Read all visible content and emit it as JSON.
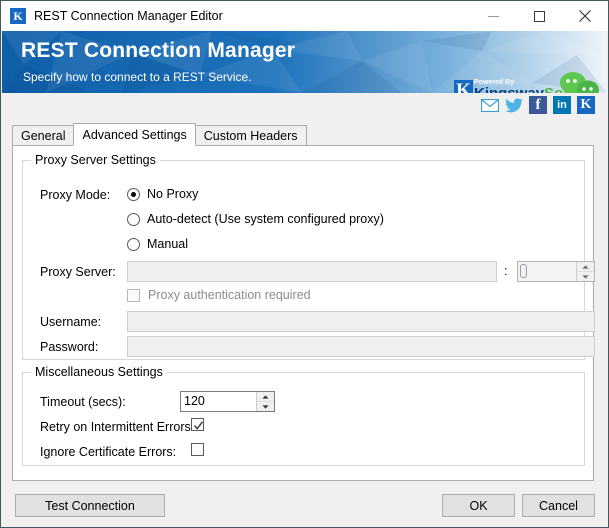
{
  "window": {
    "title": "REST Connection Manager Editor",
    "app_icon": "kingswaysoft-k-icon",
    "minimize_label": "Minimize",
    "maximize_label": "Maximize",
    "close_label": "Close"
  },
  "banner": {
    "title": "REST Connection Manager",
    "subtitle": "Specify how to connect to a REST Service.",
    "logo": {
      "powered_by": "Powered By",
      "brand_first": "Kingsway",
      "brand_second": "Soft",
      "k_letter": "K"
    },
    "colors": {
      "blue_dark": "#0f5ea8",
      "blue_mid": "#2b7fc4",
      "blue_light": "#e9f1f8",
      "brand_blue": "#0d3f7a",
      "brand_green": "#4bb648"
    }
  },
  "social": {
    "items": [
      {
        "name": "email-icon",
        "label": "Email"
      },
      {
        "name": "twitter-icon",
        "label": "Twitter"
      },
      {
        "name": "facebook-icon",
        "label": "f"
      },
      {
        "name": "linkedin-icon",
        "label": "in"
      },
      {
        "name": "kingswaysoft-icon",
        "label": "K"
      }
    ]
  },
  "tabs": [
    {
      "label": "General",
      "active": false
    },
    {
      "label": "Advanced Settings",
      "active": true
    },
    {
      "label": "Custom Headers",
      "active": false
    }
  ],
  "proxy_group": {
    "legend": "Proxy Server Settings",
    "proxy_mode_label": "Proxy Mode:",
    "modes": [
      {
        "label": "No Proxy",
        "selected": true
      },
      {
        "label": "Auto-detect (Use system configured proxy)",
        "selected": false
      },
      {
        "label": "Manual",
        "selected": false
      }
    ],
    "proxy_server_label": "Proxy Server:",
    "proxy_server_value": "",
    "port_separator": ":",
    "port_value": "0",
    "proxy_auth_label": "Proxy authentication required",
    "proxy_auth_checked": false,
    "username_label": "Username:",
    "username_value": "",
    "password_label": "Password:",
    "password_value": ""
  },
  "misc_group": {
    "legend": "Miscellaneous Settings",
    "timeout_label": "Timeout (secs):",
    "timeout_value": "120",
    "retry_label": "Retry on Intermittent Errors:",
    "retry_checked": true,
    "ignore_cert_label": "Ignore Certificate Errors:",
    "ignore_cert_checked": false
  },
  "footer": {
    "test_connection": "Test Connection",
    "ok": "OK",
    "cancel": "Cancel"
  }
}
